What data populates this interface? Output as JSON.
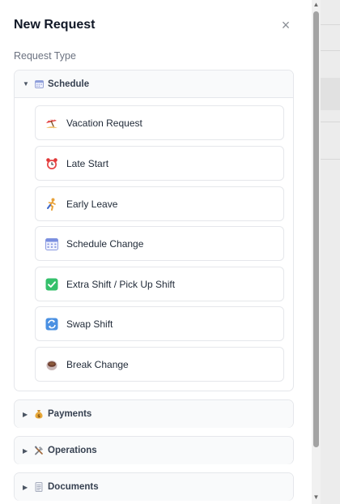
{
  "panel": {
    "title": "New Request",
    "close_symbol": "×",
    "section_label": "Request Type"
  },
  "groups": [
    {
      "label": "Schedule",
      "icon": "calendar-icon",
      "expanded": true,
      "items": [
        {
          "label": "Vacation Request",
          "icon": "beach-umbrella-icon"
        },
        {
          "label": "Late Start",
          "icon": "alarm-clock-icon"
        },
        {
          "label": "Early Leave",
          "icon": "running-person-icon"
        },
        {
          "label": "Schedule Change",
          "icon": "calendar-icon"
        },
        {
          "label": "Extra Shift / Pick Up Shift",
          "icon": "check-mark-icon"
        },
        {
          "label": "Swap Shift",
          "icon": "swap-arrows-icon"
        },
        {
          "label": "Break Change",
          "icon": "coffee-cup-icon"
        }
      ]
    },
    {
      "label": "Payments",
      "icon": "money-bag-icon",
      "expanded": false
    },
    {
      "label": "Operations",
      "icon": "tools-icon",
      "expanded": false
    },
    {
      "label": "Documents",
      "icon": "document-icon",
      "expanded": false
    }
  ],
  "colors": {
    "check_green": "#34c06b",
    "swap_blue": "#4a90e2",
    "scroll_thumb": "#a3a3a3"
  }
}
